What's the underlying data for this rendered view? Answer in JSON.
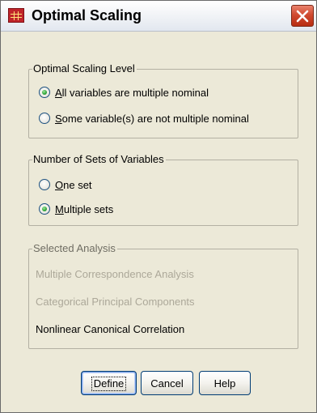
{
  "window": {
    "title": "Optimal Scaling",
    "close_glyph": "✕"
  },
  "icons": {
    "app": "spss-data-grid-icon",
    "close": "close-icon"
  },
  "colors": {
    "dialog_bg": "#ece9d8",
    "radio_checked": "#2ca334",
    "disabled_text": "#aca899",
    "close_button": "#d04a30"
  },
  "scaling_level": {
    "label": "Optimal Scaling Level",
    "options": [
      {
        "label": "All variables are multiple nominal",
        "mnemonic": "A",
        "checked": true
      },
      {
        "label": "Some variable(s) are not multiple nominal",
        "mnemonic": "S",
        "checked": false
      }
    ]
  },
  "num_sets": {
    "label": "Number of Sets of Variables",
    "options": [
      {
        "label": "One set",
        "mnemonic": "O",
        "checked": false
      },
      {
        "label": "Multiple sets",
        "mnemonic": "M",
        "checked": true
      }
    ]
  },
  "selected_analysis": {
    "label": "Selected Analysis",
    "items": [
      {
        "label": "Multiple Correspondence Analysis",
        "enabled": false
      },
      {
        "label": "Categorical Principal Components",
        "enabled": false
      },
      {
        "label": "Nonlinear Canonical Correlation",
        "enabled": true
      }
    ]
  },
  "buttons": {
    "define": "Define",
    "cancel": "Cancel",
    "help": "Help"
  }
}
